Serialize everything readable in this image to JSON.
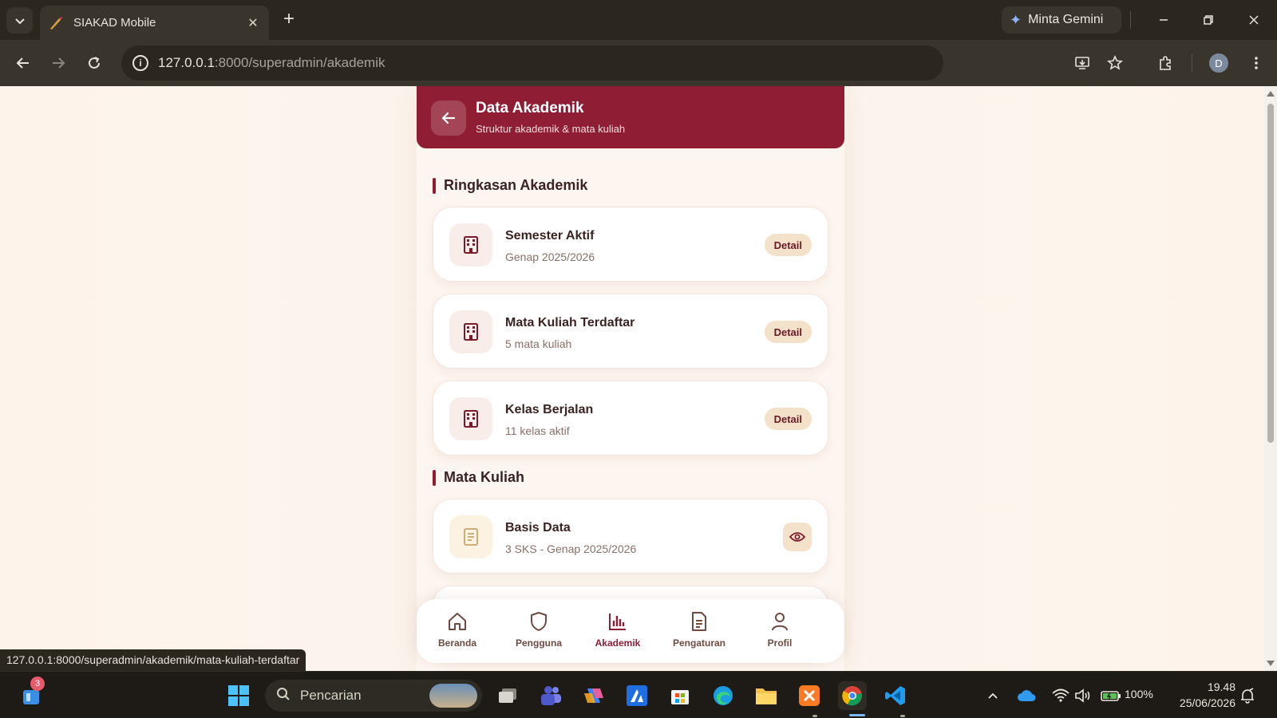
{
  "browser": {
    "tab_title": "SIAKAD Mobile",
    "new_tab_symbol": "+",
    "gemini_label": "Minta Gemini",
    "url_host": "127.0.0.1",
    "url_rest": ":8000/superadmin/akademik",
    "profile_initial": "D",
    "status_url": "127.0.0.1:8000/superadmin/akademik/mata-kuliah-terdaftar"
  },
  "header": {
    "title": "Data Akademik",
    "subtitle": "Struktur akademik & mata kuliah"
  },
  "sections": {
    "summary_title": "Ringkasan Akademik",
    "courses_title": "Mata Kuliah"
  },
  "summary_cards": [
    {
      "title": "Semester Aktif",
      "subtitle": "Genap 2025/2026",
      "button": "Detail",
      "icon": "building-icon"
    },
    {
      "title": "Mata Kuliah Terdaftar",
      "subtitle": "5 mata kuliah",
      "button": "Detail",
      "icon": "building-icon"
    },
    {
      "title": "Kelas Berjalan",
      "subtitle": "11 kelas aktif",
      "button": "Detail",
      "icon": "building-icon"
    }
  ],
  "courses": [
    {
      "title": "Basis Data",
      "subtitle": "3 SKS - Genap 2025/2026",
      "icon": "document-icon",
      "action_icon": "eye-icon"
    }
  ],
  "bottom_nav": [
    {
      "label": "Beranda",
      "icon": "home-icon",
      "active": false
    },
    {
      "label": "Pengguna",
      "icon": "shield-icon",
      "active": false
    },
    {
      "label": "Akademik",
      "icon": "bar-chart-icon",
      "active": true
    },
    {
      "label": "Pengaturan",
      "icon": "document-icon",
      "active": false
    },
    {
      "label": "Profil",
      "icon": "user-icon",
      "active": false
    }
  ],
  "taskbar": {
    "notification_count": "3",
    "search_placeholder": "Pencarian",
    "battery": "100%",
    "time": "19.48",
    "date": "25/06/2026"
  },
  "colors": {
    "brand": "#8f1d33",
    "accent_soft": "#f3e1c9",
    "page_bg": "#fdf5ef"
  }
}
